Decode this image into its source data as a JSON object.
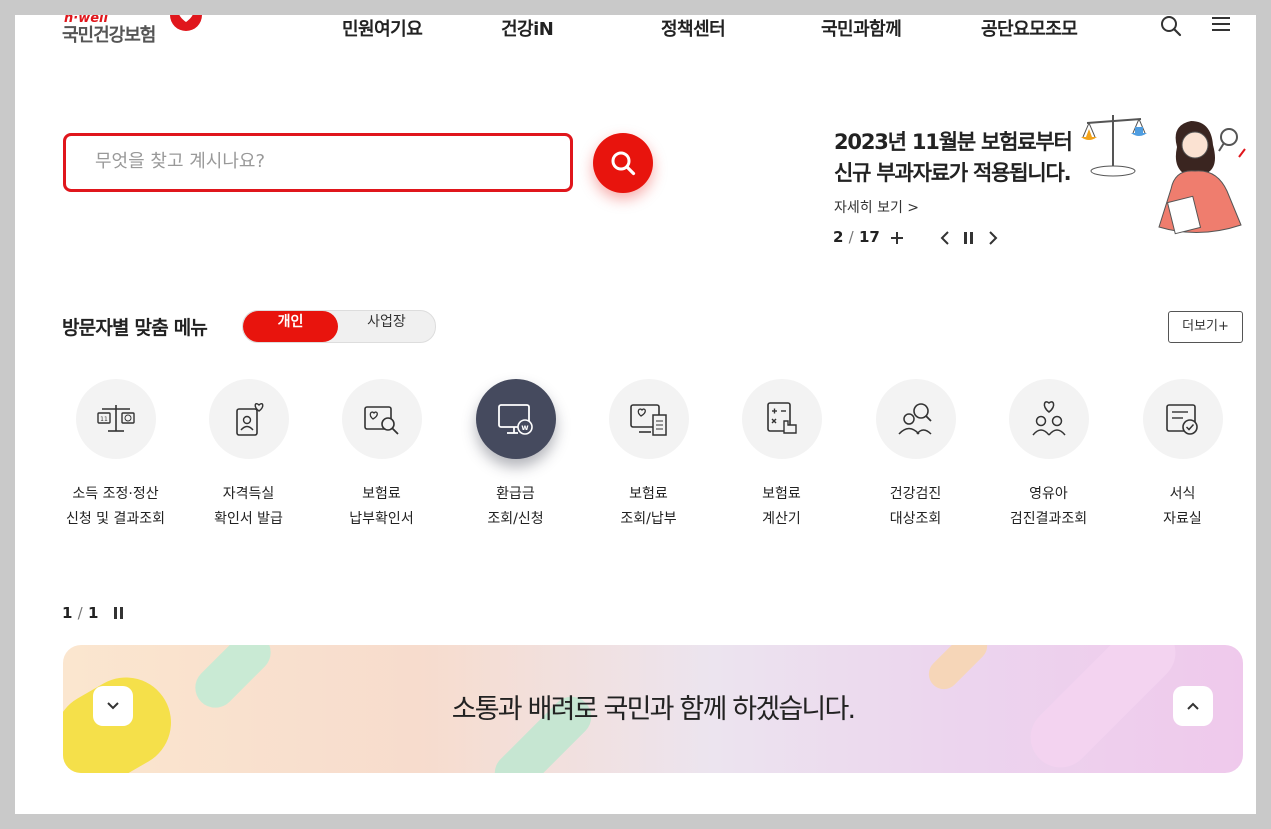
{
  "header": {
    "logo_small": "h·well",
    "logo_name": "국민건강보험",
    "nav": [
      "민원여기요",
      "건강iN",
      "정책센터",
      "국민과함께",
      "공단요모조모"
    ],
    "search_icon": "search-icon",
    "menu_icon": "hamburger-menu-icon"
  },
  "search": {
    "placeholder": "무엇을 찾고 계시나요?",
    "button_icon": "search-icon"
  },
  "promo": {
    "title_line1": "2023년 11월분 보험료부터",
    "title_line2": "신규 부과자료가 적용됩니다.",
    "more_label": "자세히 보기 >",
    "current": "2",
    "separator": "/",
    "total": "17",
    "controls": [
      "plus-icon",
      "prev-icon",
      "pause-icon",
      "next-icon"
    ]
  },
  "visitor_menu": {
    "title": "방문자별 맞춤 메뉴",
    "tab_personal": "개인",
    "tab_business": "사업장",
    "more_label": "더보기+",
    "items": [
      {
        "line1": "소득 조정·정산",
        "line2": "신청 및 결과조회",
        "icon": "scale-icon"
      },
      {
        "line1": "자격득실",
        "line2": "확인서 발급",
        "icon": "certificate-icon"
      },
      {
        "line1": "보험료",
        "line2": "납부확인서",
        "icon": "payment-search-icon"
      },
      {
        "line1": "환급금",
        "line2": "조회/신청",
        "icon": "refund-monitor-icon"
      },
      {
        "line1": "보험료",
        "line2": "조회/납부",
        "icon": "bill-monitor-icon"
      },
      {
        "line1": "보험료",
        "line2": "계산기",
        "icon": "calculator-icon"
      },
      {
        "line1": "건강검진",
        "line2": "대상조회",
        "icon": "checkup-people-icon"
      },
      {
        "line1": "영유아",
        "line2": "검진결과조회",
        "icon": "infant-care-icon"
      },
      {
        "line1": "서식",
        "line2": "자료실",
        "icon": "form-document-icon"
      }
    ],
    "pager_current": "1",
    "pager_separator": "/",
    "pager_total": "1"
  },
  "bottom_banner": {
    "text": "소통과 배려로 국민과 함께 하겠습니다.",
    "left_icon": "chevron-down-icon",
    "right_icon": "chevron-up-icon"
  },
  "colors": {
    "brand_red": "#e8140d",
    "active_icon_bg": "#454a5e"
  }
}
